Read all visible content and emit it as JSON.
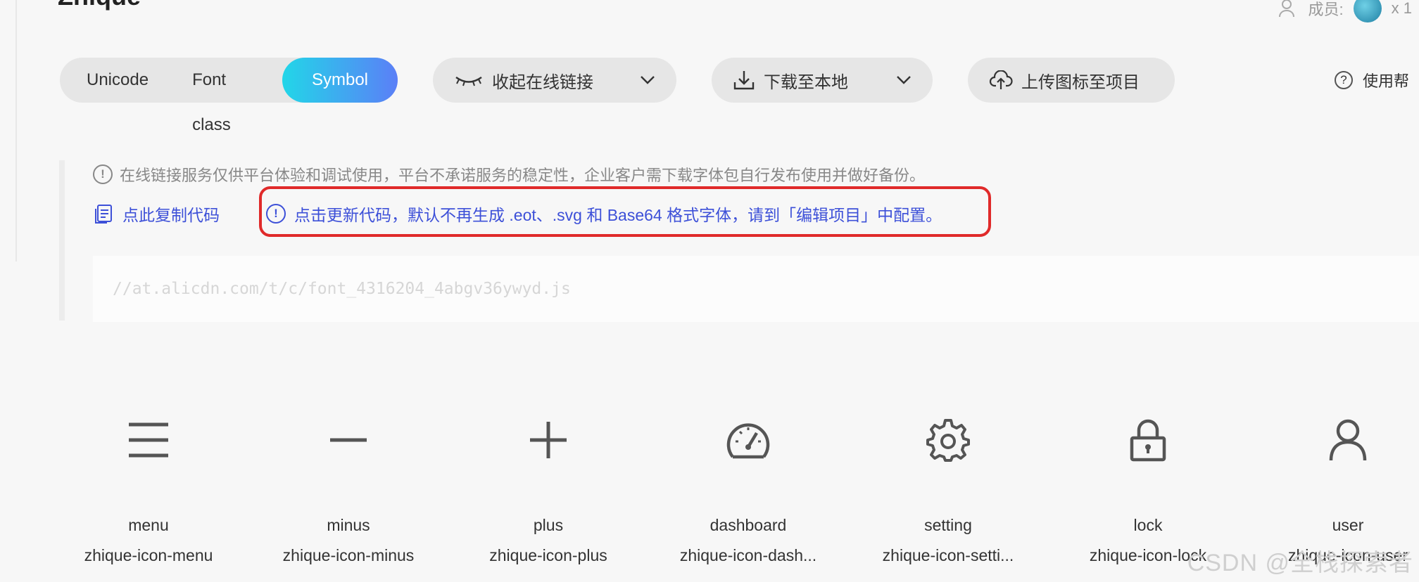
{
  "header": {
    "title_crop": "Zhique",
    "members_label": "成员:",
    "members_count": "x 1"
  },
  "modes": [
    {
      "label": "Unicode",
      "active": false
    },
    {
      "label": "Font class",
      "active": false
    },
    {
      "label": "Symbol",
      "active": true
    }
  ],
  "toolbar": {
    "collect_label": "收起在线链接",
    "download_label": "下载至本地",
    "upload_label": "上传图标至项目",
    "help_label": "使用帮"
  },
  "notice": {
    "info_text": "在线链接服务仅供平台体验和调试使用，平台不承诺服务的稳定性，企业客户需下载字体包自行发布使用并做好备份。",
    "copy_label": "点此复制代码",
    "update_text": "点击更新代码，默认不再生成 .eot、.svg 和 Base64 格式字体，请到「编辑项目」中配置。"
  },
  "code_url": "//at.alicdn.com/t/c/font_4316204_4abgv36ywyd.js",
  "icons": [
    {
      "name": "menu",
      "class": "zhique-icon-menu",
      "icon": "menu-icon"
    },
    {
      "name": "minus",
      "class": "zhique-icon-minus",
      "icon": "minus-icon"
    },
    {
      "name": "plus",
      "class": "zhique-icon-plus",
      "icon": "plus-icon"
    },
    {
      "name": "dashboard",
      "class": "zhique-icon-dash...",
      "icon": "dashboard-icon"
    },
    {
      "name": "setting",
      "class": "zhique-icon-setti...",
      "icon": "setting-icon"
    },
    {
      "name": "lock",
      "class": "zhique-icon-lock",
      "icon": "lock-icon"
    },
    {
      "name": "user",
      "class": "zhique-icon-user",
      "icon": "user-icon"
    }
  ],
  "watermark": "CSDN @全栈探索者",
  "colors": {
    "accent_start": "#22d6e8",
    "accent_end": "#5b7ff7",
    "link": "#3d50d8",
    "highlight": "#e02a2a"
  }
}
